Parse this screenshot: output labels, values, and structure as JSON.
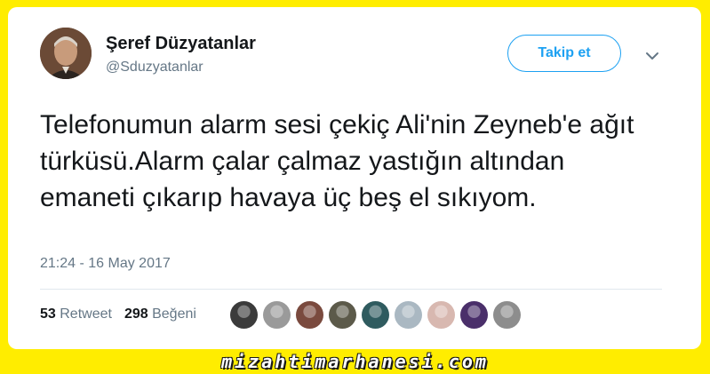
{
  "tweet": {
    "display_name": "Şeref Düzyatanlar",
    "handle": "@Sduzyatanlar",
    "follow_label": "Takip et",
    "text": "Telefonumun alarm sesi çekiç Ali'nin Zeyneb'e ağıt türküsü.Alarm çalar çalmaz yastığın altından emaneti çıkarıp havaya üç beş el sıkıyom.",
    "timestamp": "21:24 - 16 May 2017",
    "retweet_count": "53",
    "retweet_label": "Retweet",
    "like_count": "298",
    "like_label": "Beğeni"
  },
  "watermark": "mizahtimarhanesi.com",
  "colors": {
    "background": "#ffed00",
    "accent": "#1da1f2",
    "text_primary": "#14171a",
    "text_secondary": "#657786"
  },
  "icons": {
    "menu": "chevron-down-icon"
  },
  "liker_avatars": [
    {
      "name": "liker-avatar-1",
      "color": "#3b3b3b"
    },
    {
      "name": "liker-avatar-2",
      "color": "#9a9a9a"
    },
    {
      "name": "liker-avatar-3",
      "color": "#7a4a3e"
    },
    {
      "name": "liker-avatar-4",
      "color": "#5c5a4a"
    },
    {
      "name": "liker-avatar-5",
      "color": "#2f5b5f"
    },
    {
      "name": "liker-avatar-6",
      "color": "#aab8c2"
    },
    {
      "name": "liker-avatar-7",
      "color": "#d8b8b0"
    },
    {
      "name": "liker-avatar-8",
      "color": "#4a2f6a"
    },
    {
      "name": "liker-avatar-9",
      "color": "#8d8d8d"
    }
  ]
}
